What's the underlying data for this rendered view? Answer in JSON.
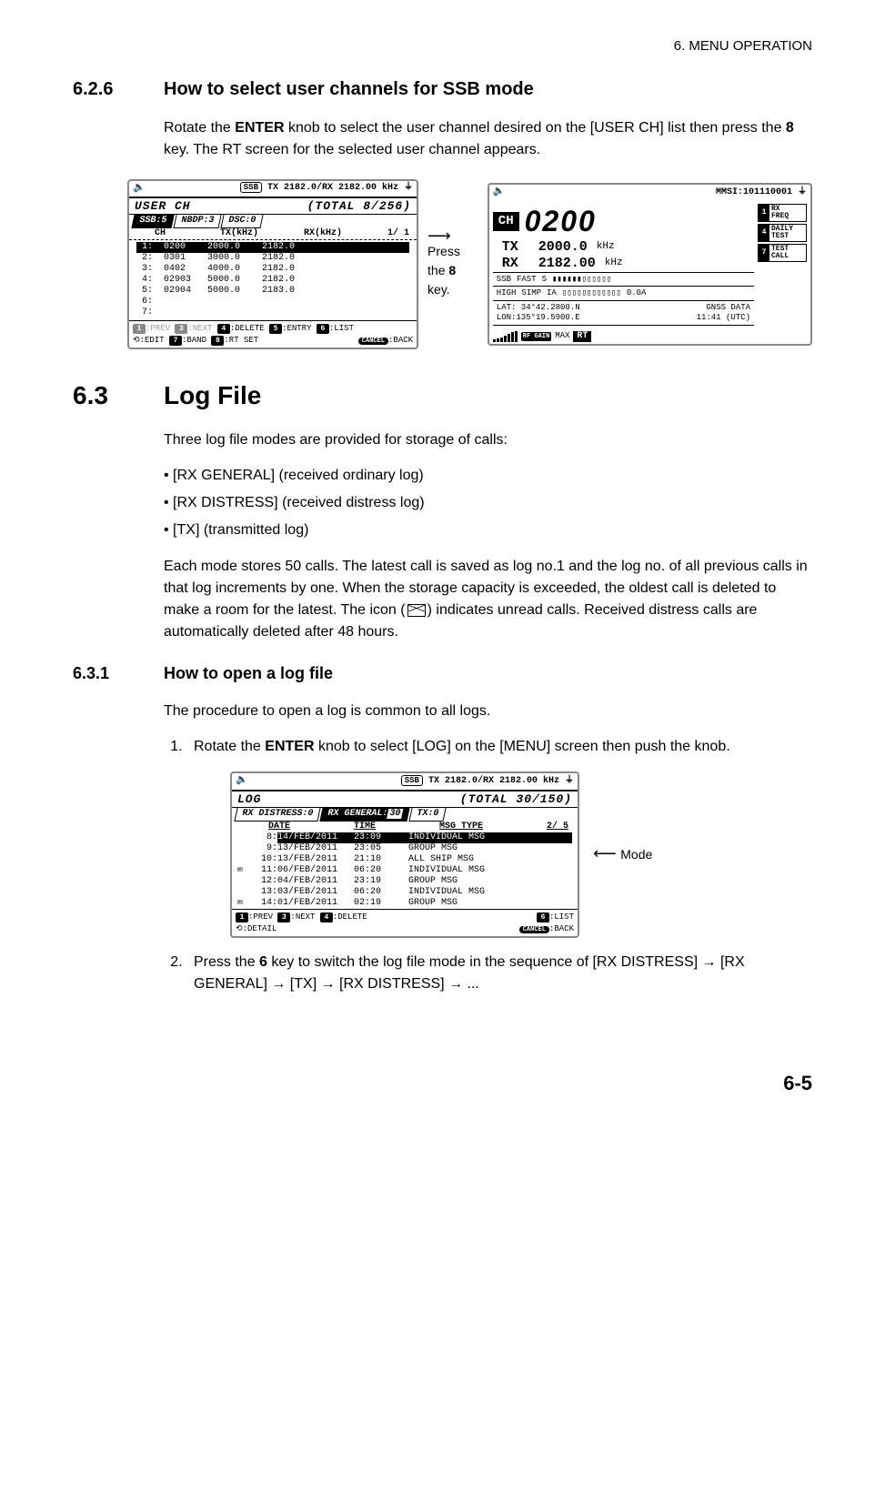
{
  "header": "6.  MENU OPERATION",
  "s626": {
    "num": "6.2.6",
    "title": "How to select user channels for SSB mode",
    "para_pre": "Rotate the ",
    "para_b1": "ENTER",
    "para_mid": " knob to select the user channel desired on the [USER CH] list then press the ",
    "para_b2": "8",
    "para_post": " key. The RT screen for the selected user channel appears."
  },
  "screen1": {
    "top_freq": "TX 2182.0/RX 2182.00 kHz",
    "ssb": "SSB",
    "title": "USER CH",
    "total": "(TOTAL   8/256)",
    "tabs": {
      "ssb": "SSB:5",
      "nbdp": "NBDP:3",
      "dsc": "DSC:0"
    },
    "cols": {
      "ch": "CH",
      "tx": "TX(kHz)",
      "rx": "RX(kHz)",
      "page": "1/ 1"
    },
    "rows": [
      {
        "n": "1:",
        "ch": "0200",
        "tx": "2000.0",
        "rx": "2182.0",
        "sel": true
      },
      {
        "n": "2:",
        "ch": "0301",
        "tx": "3000.0",
        "rx": "2182.0",
        "sel": false
      },
      {
        "n": "3:",
        "ch": "0402",
        "tx": "4000.0",
        "rx": "2182.0",
        "sel": false
      },
      {
        "n": "4:",
        "ch": "02903",
        "tx": "5000.0",
        "rx": "2182.0",
        "sel": false
      },
      {
        "n": "5:",
        "ch": "02904",
        "tx": "5000.0",
        "rx": "2183.0",
        "sel": false
      },
      {
        "n": "6:",
        "ch": "",
        "tx": "",
        "rx": "",
        "sel": false
      },
      {
        "n": "7:",
        "ch": "",
        "tx": "",
        "rx": "",
        "sel": false
      }
    ],
    "soft1": {
      "k1": "1",
      "l1": ":PREV",
      "k3": "3",
      "l3": ":NEXT",
      "k4": "4",
      "l4": ":DELETE",
      "k5": "5",
      "l5": ":ENTRY",
      "k6": "6",
      "l6": ":LIST"
    },
    "soft2": {
      "edit": ":EDIT",
      "k7": "7",
      "l7": ":BAND",
      "k8": "8",
      "l8": ":RT SET",
      "cancel": "CANCEL",
      "back": ":BACK"
    }
  },
  "arrow": {
    "pre": "Press the ",
    "b": "8",
    "post": " key."
  },
  "screen2": {
    "mmsi": "MMSI:101110001",
    "ch_label": "CH",
    "ch_num": "0200",
    "tx_label": "TX",
    "tx_val": "2000.0",
    "rx_label": "RX",
    "rx_val": "2182.00",
    "khz": "kHz",
    "status": {
      "ssb": "SSB",
      "fast": "FAST",
      "s": "S",
      "high": "HIGH",
      "simp": "SIMP",
      "ia": "IA",
      "amps": "0.0A"
    },
    "pos": {
      "lat": "LAT: 34°42.2800.N",
      "lon": "LON:135°19.5900.E",
      "gnss": "GNSS DATA",
      "time": "11:41 (UTC)"
    },
    "side": [
      {
        "n": "1",
        "l": "RX\nFREQ"
      },
      {
        "n": "4",
        "l": "DAILY\nTEST"
      },
      {
        "n": "7",
        "l": "TEST\nCALL"
      }
    ],
    "rfgain": "RF GAIN",
    "max": "MAX",
    "rt": "RT"
  },
  "s63": {
    "num": "6.3",
    "title": "Log File",
    "intro": "Three log file modes are provided for storage of calls:",
    "bullets": [
      "[RX GENERAL] (received ordinary log)",
      "[RX DISTRESS] (received distress log)",
      "[TX] (transmitted log)"
    ],
    "para2_a": "Each mode stores 50 calls. The latest call is saved as log no.1 and the log no. of all previous calls in that log increments by one. When the storage capacity is exceeded, the oldest call is deleted to make a room for the latest. The icon (",
    "para2_b": ") indicates unread calls. Received distress calls are automatically deleted after 48 hours."
  },
  "s631": {
    "num": "6.3.1",
    "title": "How to open a log file",
    "intro": "The procedure to open a log is common to all logs.",
    "step1_a": "Rotate the ",
    "step1_b": "ENTER",
    "step1_c": " knob to select [LOG] on the [MENU] screen then push the knob.",
    "step2_a": "Press the ",
    "step2_b": "6",
    "step2_c": " key to switch the log file mode in the sequence of [RX DISTRESS] → [RX GENERAL] → [TX] → [RX DISTRESS] → ..."
  },
  "screen3": {
    "top_freq": "TX 2182.0/RX 2182.00 kHz",
    "ssb": "SSB",
    "title": "LOG",
    "total": "(TOTAL  30/150)",
    "tabs": {
      "d": "RX DISTRESS:0",
      "g": "RX GENERAL:",
      "gn": "30",
      "t": "TX:0"
    },
    "cols": {
      "date": "DATE",
      "time": "TIME",
      "msg": "MSG TYPE",
      "page": "2/ 5"
    },
    "rows": [
      {
        "mail": false,
        "n": "8:",
        "d": "14/FEB/2011",
        "t": "23:09",
        "m": "INDIVIDUAL MSG",
        "sel": true
      },
      {
        "mail": false,
        "n": "9:",
        "d": "13/FEB/2011",
        "t": "23:05",
        "m": "GROUP MSG",
        "sel": false
      },
      {
        "mail": false,
        "n": "10:",
        "d": "13/FEB/2011",
        "t": "21:10",
        "m": "ALL SHIP MSG",
        "sel": false
      },
      {
        "mail": true,
        "n": "11:",
        "d": "06/FEB/2011",
        "t": "06:20",
        "m": "INDIVIDUAL MSG",
        "sel": false
      },
      {
        "mail": false,
        "n": "12:",
        "d": "04/FEB/2011",
        "t": "23:19",
        "m": "GROUP MSG",
        "sel": false
      },
      {
        "mail": false,
        "n": "13:",
        "d": "03/FEB/2011",
        "t": "06:20",
        "m": "INDIVIDUAL MSG",
        "sel": false
      },
      {
        "mail": true,
        "n": "14:",
        "d": "01/FEB/2011",
        "t": "02:19",
        "m": "GROUP MSG",
        "sel": false
      }
    ],
    "soft1": {
      "k1": "1",
      "l1": ":PREV",
      "k3": "3",
      "l3": ":NEXT",
      "k4": "4",
      "l4": ":DELETE",
      "k6": "6",
      "l6": ":LIST"
    },
    "soft2": {
      "detail": ":DETAIL",
      "cancel": "CANCEL",
      "back": ":BACK"
    }
  },
  "mode_label": "Mode",
  "page_num": "6-5"
}
